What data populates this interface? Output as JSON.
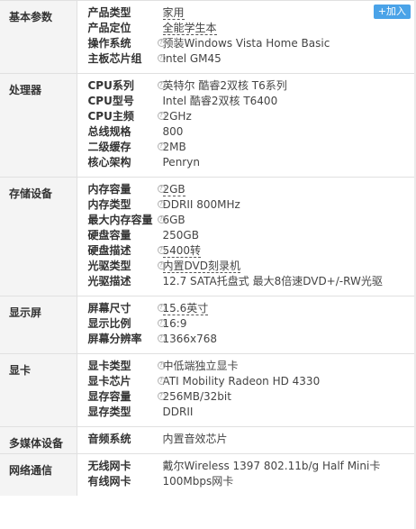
{
  "add_button": "+加入",
  "categories": [
    {
      "name": "基本参数",
      "rows": [
        {
          "key": "产品类型",
          "value": "家用",
          "underline": true
        },
        {
          "key": "产品定位",
          "value": "全能学生本",
          "underline": true
        },
        {
          "key": "操作系统",
          "value": "预装Windows Vista Home Basic",
          "underline": false,
          "help": true
        },
        {
          "key": "主板芯片组",
          "value": "Intel GM45",
          "underline": false,
          "help": true
        }
      ]
    },
    {
      "name": "处理器",
      "rows": [
        {
          "key": "CPU系列",
          "value": "英特尔 酷睿2双核 T6系列",
          "underline": false,
          "help": true
        },
        {
          "key": "CPU型号",
          "value": "Intel 酷睿2双核 T6400",
          "underline": false
        },
        {
          "key": "CPU主频",
          "value": "2GHz",
          "underline": false,
          "help": true
        },
        {
          "key": "总线规格",
          "value": "800",
          "underline": false
        },
        {
          "key": "二级缓存",
          "value": "2MB",
          "underline": false,
          "help": true
        },
        {
          "key": "核心架构",
          "value": "Penryn",
          "underline": false
        }
      ]
    },
    {
      "name": "存储设备",
      "rows": [
        {
          "key": "内存容量",
          "value": "2GB",
          "underline": true,
          "help": true
        },
        {
          "key": "内存类型",
          "value": "DDRII 800MHz",
          "underline": false,
          "help": true
        },
        {
          "key": "最大内存容量",
          "value": "6GB",
          "underline": false,
          "help": true
        },
        {
          "key": "硬盘容量",
          "value": "250GB",
          "underline": false
        },
        {
          "key": "硬盘描述",
          "value": "5400转",
          "underline": true,
          "help": true
        },
        {
          "key": "光驱类型",
          "value": "内置DVD刻录机",
          "underline": true,
          "help": true
        },
        {
          "key": "光驱描述",
          "value": "12.7 SATA托盘式 最大8倍速DVD+/-RW光驱",
          "underline": false
        }
      ]
    },
    {
      "name": "显示屏",
      "rows": [
        {
          "key": "屏幕尺寸",
          "value": "15.6英寸",
          "underline": true,
          "help": true
        },
        {
          "key": "显示比例",
          "value": "16:9",
          "underline": false,
          "help": true
        },
        {
          "key": "屏幕分辨率",
          "value": "1366x768",
          "underline": false,
          "help": true
        }
      ]
    },
    {
      "name": "显卡",
      "rows": [
        {
          "key": "显卡类型",
          "value": "中低端独立显卡",
          "underline": false,
          "help": true
        },
        {
          "key": "显卡芯片",
          "value": "ATI Mobility Radeon HD 4330",
          "underline": false,
          "help": true
        },
        {
          "key": "显存容量",
          "value": "256MB/32bit",
          "underline": false,
          "help": true
        },
        {
          "key": "显存类型",
          "value": "DDRII",
          "underline": false
        }
      ]
    },
    {
      "name": "多媒体设备",
      "rows": [
        {
          "key": "音频系统",
          "value": "内置音效芯片",
          "underline": false
        }
      ]
    },
    {
      "name": "网络通信",
      "rows": [
        {
          "key": "无线网卡",
          "value": "戴尔Wireless 1397 802.11b/g Half Mini卡",
          "underline": false
        },
        {
          "key": "有线网卡",
          "value": "100Mbps网卡",
          "underline": false
        }
      ]
    }
  ]
}
